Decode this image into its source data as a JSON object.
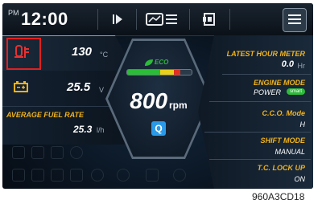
{
  "topbar": {
    "ampm": "PM",
    "time": "12:00",
    "icons": [
      "play-step-icon",
      "display-settings-icon",
      "camera-mode-icon",
      "menu-icon"
    ]
  },
  "left": {
    "coolant_temp": {
      "value": "130",
      "unit": "°C",
      "icon": "coolant-temp-icon"
    },
    "battery": {
      "value": "25.5",
      "unit": "V",
      "icon": "battery-icon"
    },
    "fuel_rate": {
      "label": "AVERAGE FUEL RATE",
      "value": "25.3",
      "unit": "l/h"
    }
  },
  "center": {
    "eco_label": "ECO",
    "eco_level": 0.82,
    "colors": {
      "eco_green": "#2dbb3a",
      "eco_yellow": "#e8d020",
      "eco_red": "#e03020",
      "accent": "#f2b31a"
    },
    "rpm_value": "800",
    "rpm_unit": "rpm",
    "mode_icon": "Q"
  },
  "right": {
    "latest_hour_meter": {
      "label": "LATEST HOUR METER",
      "value": "0.0",
      "unit": "Hr"
    },
    "engine_mode": {
      "label": "ENGINE MODE",
      "value": "POWER",
      "badge": "smart"
    },
    "cco_mode": {
      "label": "C.C.O. Mode",
      "value": "H"
    },
    "shift_mode": {
      "label": "SHIFT MODE",
      "value": "MANUAL"
    },
    "tc_lock_up": {
      "label": "T.C. LOCK UP",
      "value": "ON"
    }
  },
  "figure_code": "960A3CD18"
}
